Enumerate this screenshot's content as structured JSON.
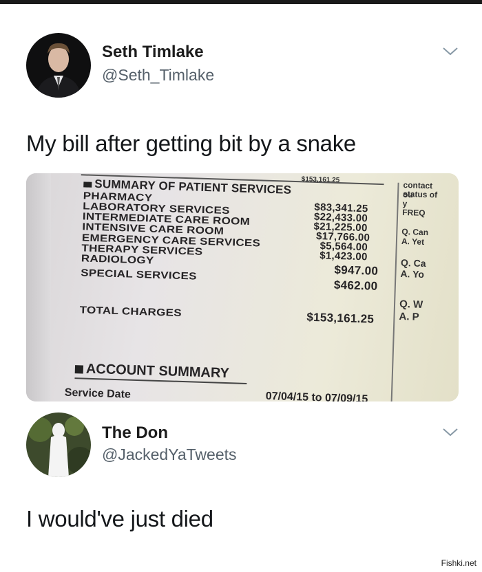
{
  "tweet1": {
    "display_name": "Seth Timlake",
    "handle": "@Seth_Timlake",
    "text": "My bill after getting bit by a snake",
    "avatar_icon": "person-suit-avatar",
    "menu_icon": "chevron-down-icon"
  },
  "bill": {
    "top_amount": "$153,161.25",
    "section_title": "SUMMARY OF PATIENT SERVICES",
    "services": [
      {
        "label": "PHARMACY",
        "amount": "$83,341.25"
      },
      {
        "label": "LABORATORY SERVICES",
        "amount": "$22,433.00"
      },
      {
        "label": "INTERMEDIATE CARE ROOM",
        "amount": "$21,225.00"
      },
      {
        "label": "INTENSIVE CARE ROOM",
        "amount": "$17,766.00"
      },
      {
        "label": "EMERGENCY CARE SERVICES",
        "amount": "$5,564.00"
      },
      {
        "label": "THERAPY SERVICES",
        "amount": "$1,423.00"
      },
      {
        "label": "RADIOLOGY",
        "amount": "$947.00"
      },
      {
        "label": "SPECIAL SERVICES",
        "amount": "$462.00"
      }
    ],
    "total_label": "TOTAL CHARGES",
    "total_amount": "$153,161.25",
    "account_summary_title": "ACCOUNT SUMMARY",
    "service_date_label": "Service Date",
    "service_date_range": "07/04/15 to 07/09/15",
    "right_column": {
      "contact_line1": "contact ou",
      "contact_line2": "status of y",
      "freq_heading": "FREQ",
      "q1": "Q. Can",
      "a1": "A. Yet",
      "q2": "Q. Ca",
      "a2": "A. Yo",
      "q3": "Q. W",
      "a3": "A. P"
    }
  },
  "tweet2": {
    "display_name": "The Don",
    "handle": "@JackedYaTweets",
    "text": "I would've just died",
    "avatar_icon": "white-figure-avatar",
    "menu_icon": "chevron-down-icon"
  },
  "watermark": "Fishki.net",
  "colors": {
    "name": "#1c1c1c",
    "handle": "#55606a",
    "text": "#14171a",
    "chevron": "#8899a6"
  }
}
